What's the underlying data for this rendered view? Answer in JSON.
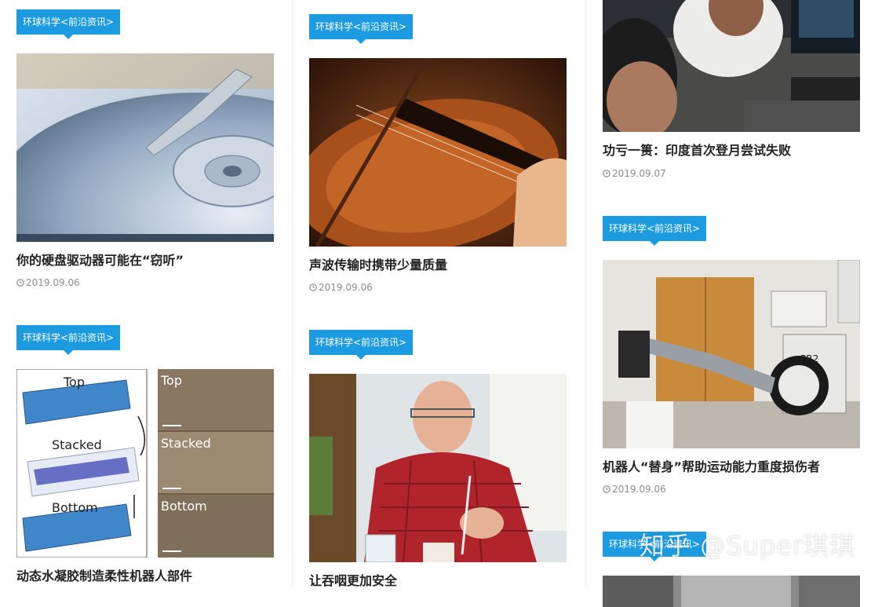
{
  "category_tag": "环球科学<前沿资讯>",
  "watermark": "知乎 @Super琪琪",
  "articles": {
    "hard_drive": {
      "title": "你的硬盘驱动器可能在“窃听”",
      "date": "2019.09.06"
    },
    "violin": {
      "title": "声波传输时携带少量质量",
      "date": "2019.09.06"
    },
    "moon_landing": {
      "title": "功亏一篑：印度首次登月尝试失败",
      "date": "2019.09.07"
    },
    "hydrogel": {
      "title": "动态水凝胶制造柔性机器人部件",
      "diagram_labels": [
        "Top",
        "Stacked",
        "Bottom"
      ]
    },
    "swallow": {
      "title": "让吞咽更加安全"
    },
    "robot": {
      "title": "机器人“替身”帮助运动能力重度损伤者",
      "date": "2019.09.06",
      "robot_label": "PR2"
    }
  },
  "colors": {
    "tag_bg": "#1d9be0",
    "title": "#222222",
    "date": "#8c8c8c"
  }
}
